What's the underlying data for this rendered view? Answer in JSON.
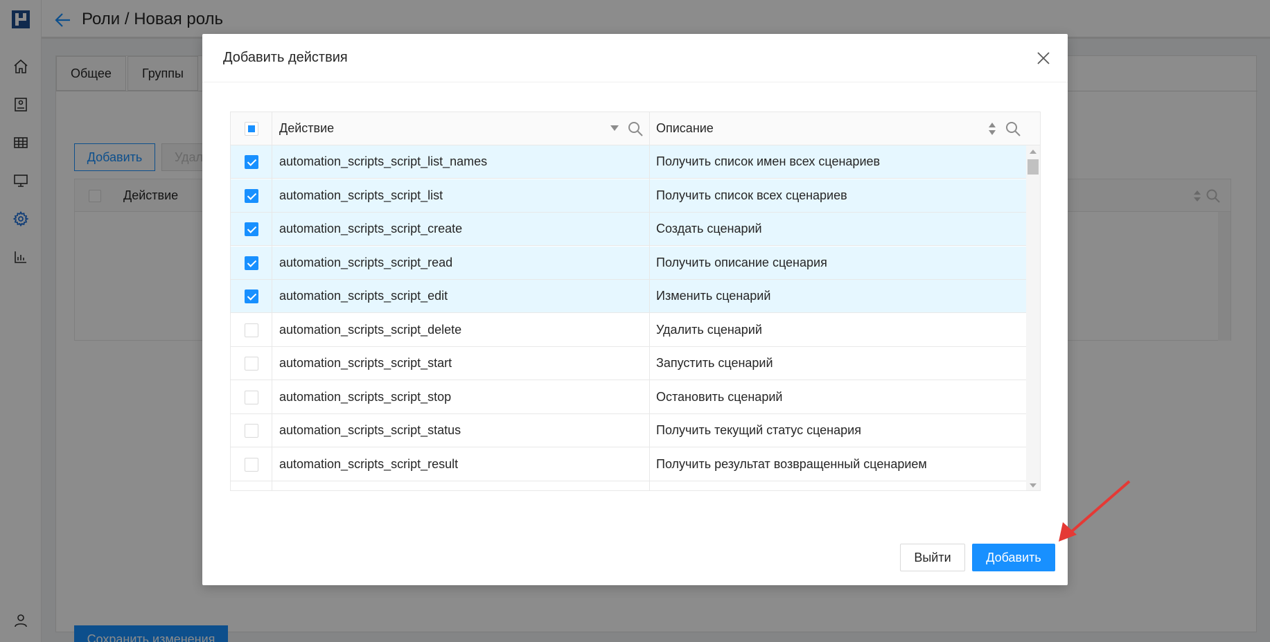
{
  "app": {
    "page_title": "Роли / Новая роль",
    "tabs": [
      {
        "label": "Общее"
      },
      {
        "label": "Группы"
      }
    ],
    "toolbar": {
      "add_label": "Добавить",
      "delete_label": "Удал"
    },
    "table": {
      "col_action": "Действие"
    },
    "save_label": "Сохранить изменения"
  },
  "modal": {
    "title": "Добавить действия",
    "columns": {
      "action": "Действие",
      "description": "Описание"
    },
    "rows": [
      {
        "action": "automation_scripts_script_list_names",
        "description": "Получить список имен всех сценариев",
        "checked": true
      },
      {
        "action": "automation_scripts_script_list",
        "description": "Получить список всех сценариев",
        "checked": true
      },
      {
        "action": "automation_scripts_script_create",
        "description": "Создать сценарий",
        "checked": true
      },
      {
        "action": "automation_scripts_script_read",
        "description": "Получить описание сценария",
        "checked": true
      },
      {
        "action": "automation_scripts_script_edit",
        "description": "Изменить сценарий",
        "checked": true
      },
      {
        "action": "automation_scripts_script_delete",
        "description": "Удалить сценарий",
        "checked": false
      },
      {
        "action": "automation_scripts_script_start",
        "description": "Запустить сценарий",
        "checked": false
      },
      {
        "action": "automation_scripts_script_stop",
        "description": "Остановить сценарий",
        "checked": false
      },
      {
        "action": "automation_scripts_script_status",
        "description": "Получить текущий статус сценария",
        "checked": false
      },
      {
        "action": "automation_scripts_script_result",
        "description": "Получить результат возвращенный сценарием",
        "checked": false
      },
      {
        "action": "",
        "description": "",
        "checked": false
      }
    ],
    "exit_label": "Выйти",
    "add_label": "Добавить"
  },
  "colors": {
    "accent": "#1890ff",
    "selected_row": "#e6f7ff",
    "annotation_arrow": "#e53935"
  },
  "icons": {
    "sidebar": [
      "logo-icon",
      "home-icon",
      "dashboard-icon",
      "table-icon",
      "monitor-icon",
      "gear-icon",
      "chart-icon",
      "user-icon"
    ]
  }
}
